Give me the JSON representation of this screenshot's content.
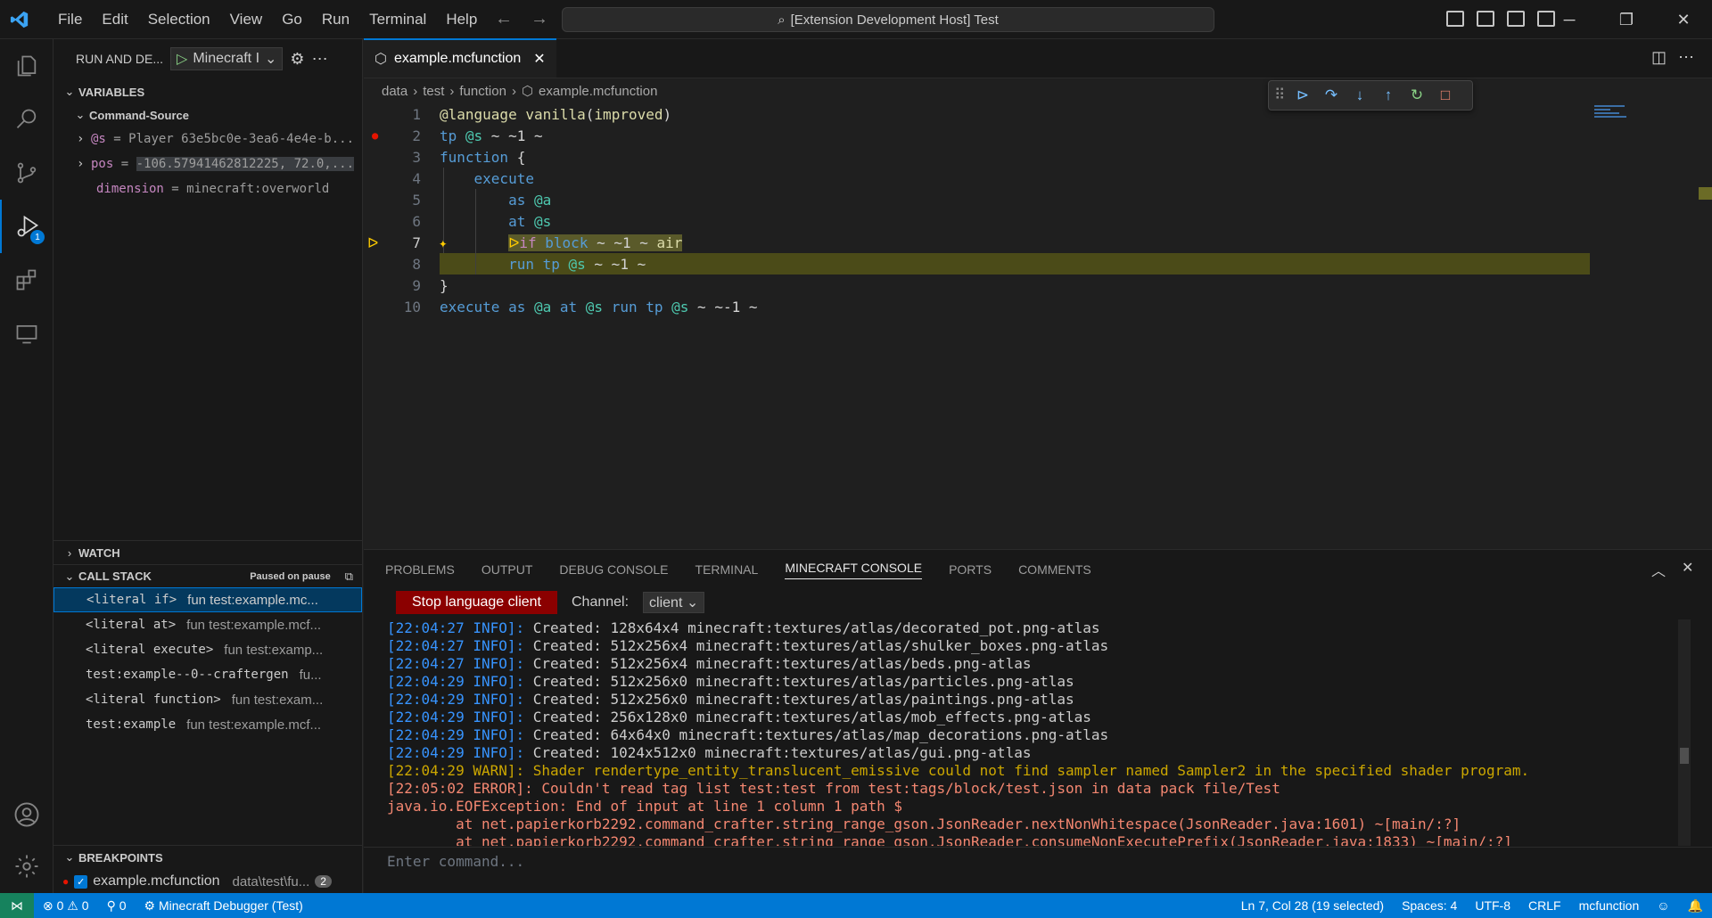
{
  "menu": [
    "File",
    "Edit",
    "Selection",
    "View",
    "Go",
    "Run",
    "Terminal",
    "Help"
  ],
  "command_center": "[Extension Development Host] Test",
  "sidebar": {
    "title": "RUN AND DE...",
    "config": "Minecraft I",
    "variables_header": "VARIABLES",
    "scope": "Command-Source",
    "vars": [
      {
        "name": "@s",
        "value": "Player 63e5bc0e-3ea6-4e4e-b..."
      },
      {
        "name": "pos",
        "value": "-106.57941462812225, 72.0,..."
      },
      {
        "name": "dimension",
        "value": "minecraft:overworld"
      }
    ],
    "watch_header": "WATCH",
    "callstack_header": "CALL STACK",
    "paused": "Paused on pause",
    "frames": [
      {
        "fn": "<literal if>",
        "src": "fun test:example.mc..."
      },
      {
        "fn": "<literal at>",
        "src": "fun test:example.mcf..."
      },
      {
        "fn": "<literal execute>",
        "src": "fun test:examp..."
      },
      {
        "fn": "test:example--0--craftergen",
        "src": "fu..."
      },
      {
        "fn": "<literal function>",
        "src": "fun test:exam..."
      },
      {
        "fn": "test:example",
        "src": "fun test:example.mcf..."
      }
    ],
    "breakpoints_header": "BREAKPOINTS",
    "breakpoint_file": "example.mcfunction",
    "breakpoint_path": "data\\test\\fu...",
    "breakpoint_count": "2"
  },
  "editor": {
    "tab": "example.mcfunction",
    "breadcrumbs": [
      "data",
      "test",
      "function",
      "example.mcfunction"
    ],
    "line_numbers": [
      "1",
      "2",
      "3",
      "4",
      "5",
      "6",
      "7",
      "8",
      "9",
      "10"
    ]
  },
  "panel": {
    "tabs": [
      "PROBLEMS",
      "OUTPUT",
      "DEBUG CONSOLE",
      "TERMINAL",
      "MINECRAFT CONSOLE",
      "PORTS",
      "COMMENTS"
    ],
    "stop_button": "Stop language client",
    "channel_label": "Channel:",
    "channel_value": "client",
    "input_placeholder": "Enter command...",
    "log": [
      {
        "t": "[22:04:27 INFO]:",
        "m": " Created: 128x64x4 minecraft:textures/atlas/decorated_pot.png-atlas",
        "k": "info"
      },
      {
        "t": "[22:04:27 INFO]:",
        "m": " Created: 512x256x4 minecraft:textures/atlas/shulker_boxes.png-atlas",
        "k": "info"
      },
      {
        "t": "[22:04:27 INFO]:",
        "m": " Created: 512x256x4 minecraft:textures/atlas/beds.png-atlas",
        "k": "info"
      },
      {
        "t": "[22:04:29 INFO]:",
        "m": " Created: 512x256x0 minecraft:textures/atlas/particles.png-atlas",
        "k": "info"
      },
      {
        "t": "[22:04:29 INFO]:",
        "m": " Created: 512x256x0 minecraft:textures/atlas/paintings.png-atlas",
        "k": "info"
      },
      {
        "t": "[22:04:29 INFO]:",
        "m": " Created: 256x128x0 minecraft:textures/atlas/mob_effects.png-atlas",
        "k": "info"
      },
      {
        "t": "[22:04:29 INFO]:",
        "m": " Created: 64x64x0 minecraft:textures/atlas/map_decorations.png-atlas",
        "k": "info"
      },
      {
        "t": "[22:04:29 INFO]:",
        "m": " Created: 1024x512x0 minecraft:textures/atlas/gui.png-atlas",
        "k": "info"
      },
      {
        "t": "[22:04:29 WARN]:",
        "m": " Shader rendertype_entity_translucent_emissive could not find sampler named Sampler2 in the specified shader program.",
        "k": "warn"
      },
      {
        "t": "[22:05:02 ERROR]:",
        "m": " Couldn't read tag list test:test from test:tags/block/test.json in data pack file/Test",
        "k": "err"
      },
      {
        "t": "",
        "m": "java.io.EOFException: End of input at line 1 column 1 path $",
        "k": "err"
      },
      {
        "t": "",
        "m": "        at net.papierkorb2292.command_crafter.string_range_gson.JsonReader.nextNonWhitespace(JsonReader.java:1601) ~[main/:?]",
        "k": "err"
      },
      {
        "t": "",
        "m": "        at net.papierkorb2292.command_crafter.string_range_gson.JsonReader.consumeNonExecutePrefix(JsonReader.java:1833) ~[main/:?]",
        "k": "err"
      }
    ]
  },
  "status": {
    "errors": "0",
    "warnings": "0",
    "ports": "0",
    "debug": "Minecraft Debugger (Test)",
    "position": "Ln 7, Col 28 (19 selected)",
    "spaces": "Spaces: 4",
    "encoding": "UTF-8",
    "eol": "CRLF",
    "language": "mcfunction"
  },
  "colors": {
    "accent": "#0078d4",
    "statusbar": "#0078d4",
    "current_line": "#4b4b18"
  }
}
